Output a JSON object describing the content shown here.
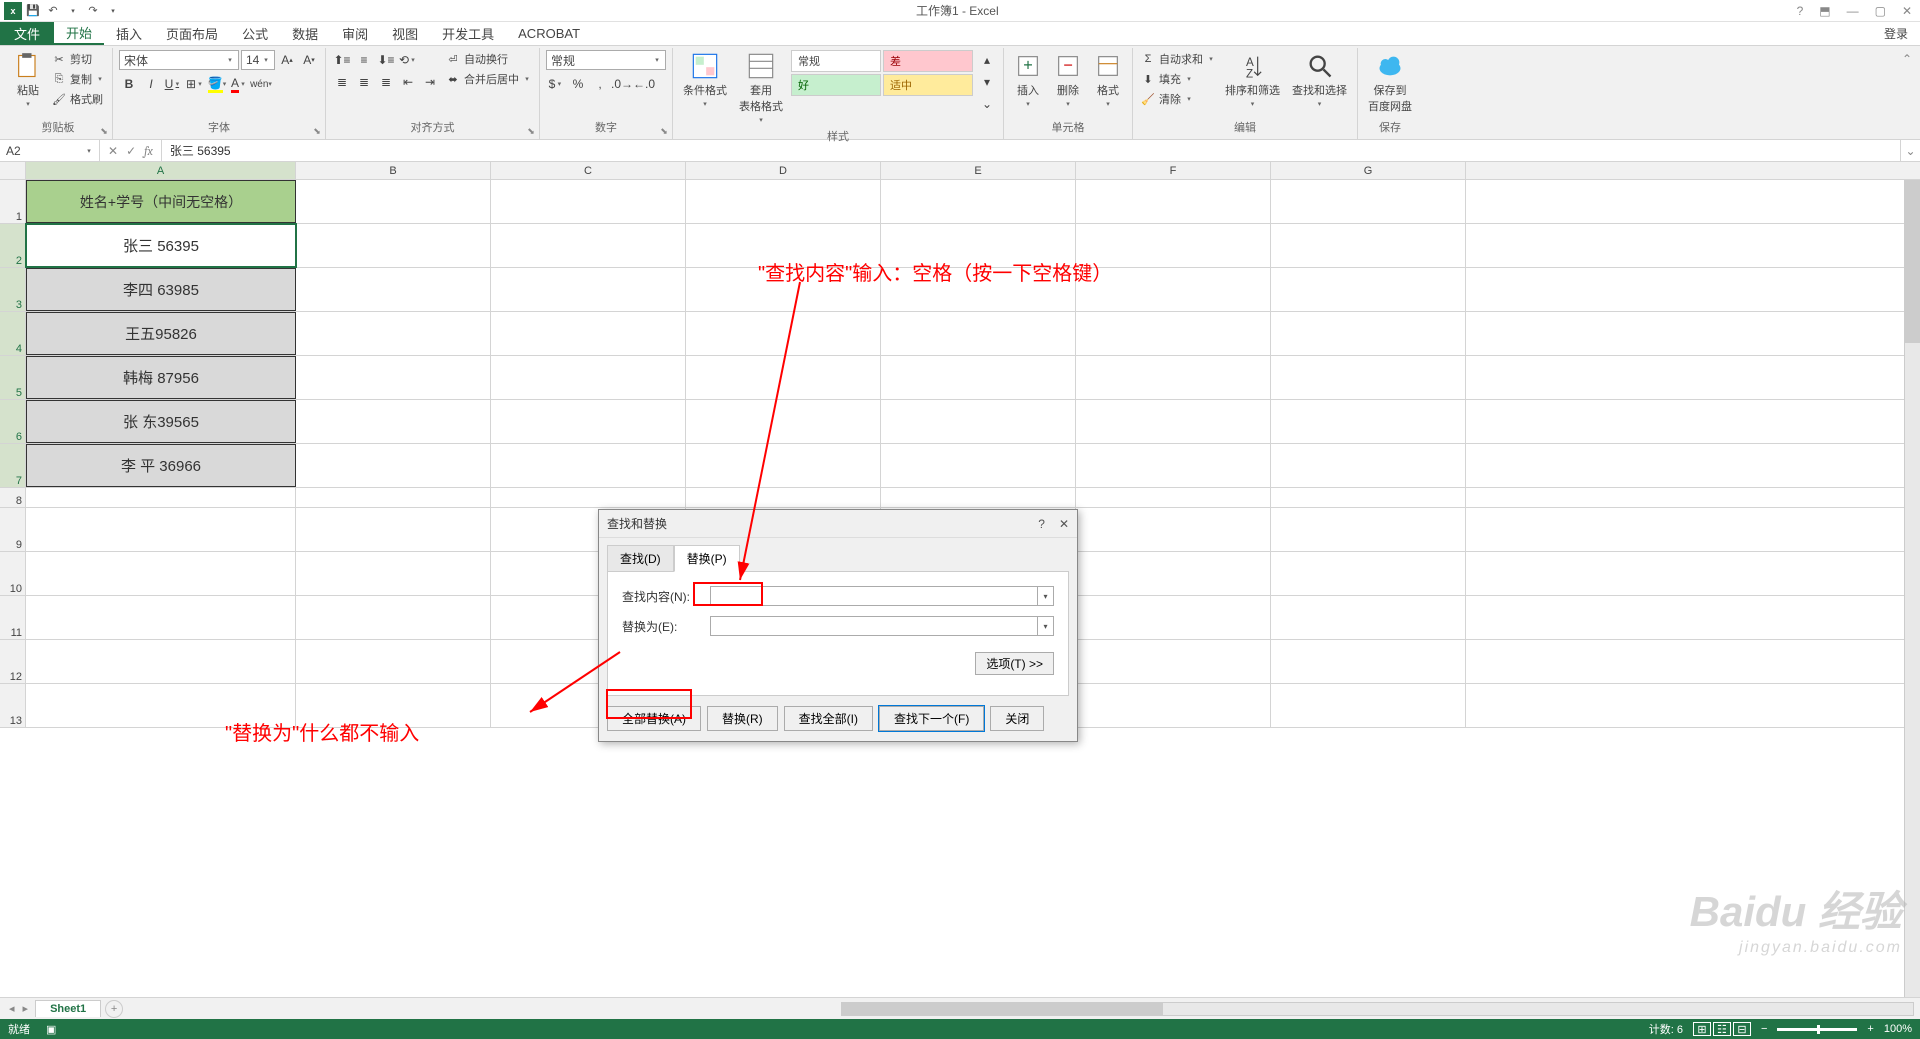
{
  "titlebar": {
    "app_title": "工作簿1 - Excel",
    "login": "登录"
  },
  "ribbon_tabs": {
    "file": "文件",
    "tabs": [
      "开始",
      "插入",
      "页面布局",
      "公式",
      "数据",
      "审阅",
      "视图",
      "开发工具",
      "ACROBAT"
    ]
  },
  "ribbon": {
    "clipboard": {
      "title": "剪贴板",
      "paste": "粘贴",
      "cut": "剪切",
      "copy": "复制",
      "painter": "格式刷"
    },
    "font": {
      "title": "字体",
      "name": "宋体",
      "size": "14",
      "bold": "B",
      "italic": "I",
      "underline": "U"
    },
    "align": {
      "title": "对齐方式",
      "wrap": "自动换行",
      "merge": "合并后居中"
    },
    "number": {
      "title": "数字",
      "format": "常规"
    },
    "styles": {
      "title": "样式",
      "cond": "条件格式",
      "table": "套用\n表格格式",
      "normal": "常规",
      "good": "好",
      "bad": "差",
      "neutral": "适中"
    },
    "cells": {
      "title": "单元格",
      "insert": "插入",
      "delete": "删除",
      "format": "格式"
    },
    "editing": {
      "title": "编辑",
      "autosum": "自动求和",
      "fill": "填充",
      "clear": "清除",
      "sort": "排序和筛选",
      "find": "查找和选择"
    },
    "save": {
      "title": "保存",
      "baidu": "保存到\n百度网盘"
    }
  },
  "formula_bar": {
    "name_box": "A2",
    "formula": "张三 56395"
  },
  "grid": {
    "columns": [
      "A",
      "B",
      "C",
      "D",
      "E",
      "F",
      "G"
    ],
    "header_cell": "姓名+学号（中间无空格）",
    "rows": [
      "张三 56395",
      "李四 63985",
      "王五95826",
      "韩梅 87956",
      "张 东39565",
      "李 平 36966"
    ]
  },
  "dialog": {
    "title": "查找和替换",
    "tab_find": "查找(D)",
    "tab_replace": "替换(P)",
    "find_label": "查找内容(N):",
    "replace_label": "替换为(E):",
    "find_value": "",
    "replace_value": "",
    "options": "选项(T) >>",
    "replace_all": "全部替换(A)",
    "replace_btn": "替换(R)",
    "find_all": "查找全部(I)",
    "find_next": "查找下一个(F)",
    "close": "关闭"
  },
  "annotations": {
    "top": "\"查找内容\"输入：空格（按一下空格键）",
    "bottom": "\"替换为\"什么都不输入"
  },
  "sheet_tabs": {
    "sheet1": "Sheet1"
  },
  "status_bar": {
    "ready": "就绪",
    "count": "计数: 6",
    "zoom": "100%"
  },
  "watermark": {
    "main": "Baidu 经验",
    "sub": "jingyan.baidu.com"
  }
}
